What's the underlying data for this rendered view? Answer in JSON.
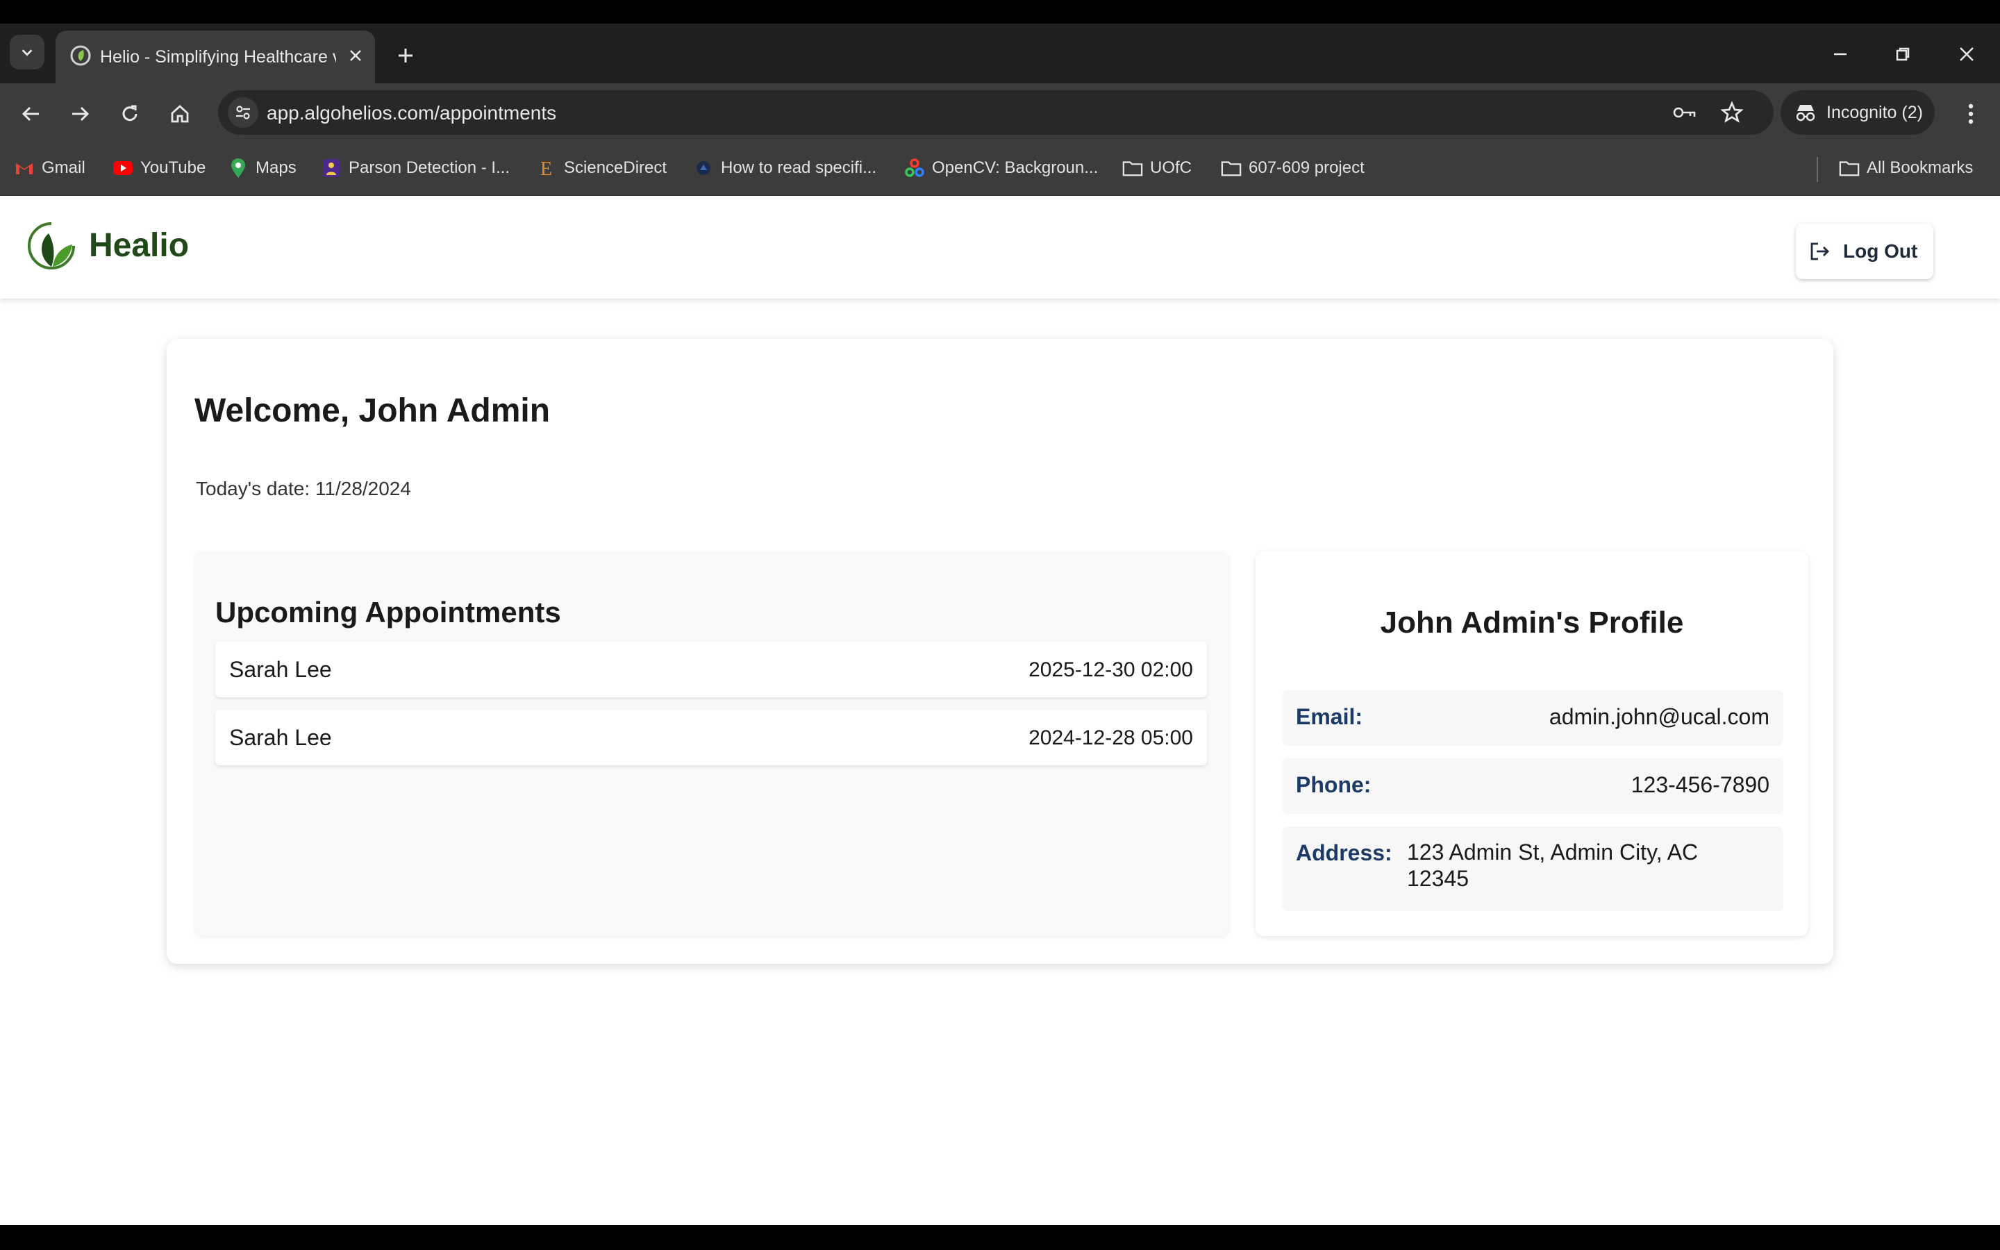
{
  "browser": {
    "tab_title": "Helio - Simplifying Healthcare v",
    "url": "app.algohelios.com/appointments",
    "incognito_label": "Incognito (2)",
    "bookmarks": [
      {
        "label": "Gmail",
        "icon": "gmail-icon"
      },
      {
        "label": "YouTube",
        "icon": "youtube-icon"
      },
      {
        "label": "Maps",
        "icon": "maps-icon"
      },
      {
        "label": "Parson Detection - I...",
        "icon": "person-detection-icon"
      },
      {
        "label": "ScienceDirect",
        "icon": "sciencedirect-icon"
      },
      {
        "label": "How to read specifi...",
        "icon": "page-icon"
      },
      {
        "label": "OpenCV: Backgroun...",
        "icon": "opencv-icon"
      },
      {
        "label": "UOfC",
        "icon": "folder-icon"
      },
      {
        "label": "607-609 project",
        "icon": "folder-icon"
      }
    ],
    "all_bookmarks_label": "All Bookmarks"
  },
  "header": {
    "brand": "Healio",
    "logout_label": "Log Out"
  },
  "main": {
    "welcome": "Welcome, John Admin",
    "date_text": "Today's date: 11/28/2024",
    "appointments": {
      "title": "Upcoming Appointments",
      "items": [
        {
          "name": "Sarah Lee",
          "datetime": "2025-12-30 02:00"
        },
        {
          "name": "Sarah Lee",
          "datetime": "2024-12-28 05:00"
        }
      ]
    },
    "profile": {
      "title": "John Admin's Profile",
      "email_label": "Email:",
      "email": "admin.john@ucal.com",
      "phone_label": "Phone:",
      "phone": "123-456-7890",
      "address_label": "Address:",
      "address": "123 Admin St, Admin City, AC 12345"
    }
  },
  "colors": {
    "brand_green": "#1f4a17",
    "label_blue": "#1c3a66",
    "chrome_dark": "#3c3c3c"
  }
}
